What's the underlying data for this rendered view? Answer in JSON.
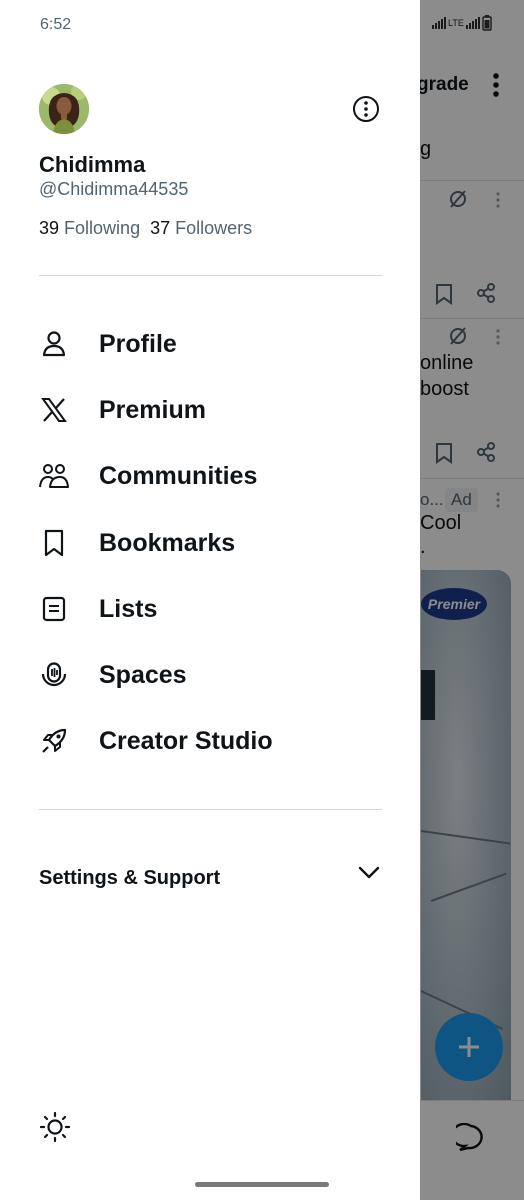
{
  "status_bar": {
    "time": "6:52",
    "signal_icon": "signal-bars-icon",
    "network": "LTE",
    "battery_icon": "battery-icon"
  },
  "profile": {
    "display_name": "Chidimma",
    "handle": "@Chidimma44535",
    "following_count": "39",
    "following_label": "Following",
    "followers_count": "37",
    "followers_label": "Followers",
    "avatar_icon": "avatar",
    "more_icon": "more-options-circle-icon"
  },
  "menu": {
    "items": [
      {
        "label": "Profile",
        "icon": "person-icon"
      },
      {
        "label": "Premium",
        "icon": "x-logo-icon"
      },
      {
        "label": "Communities",
        "icon": "communities-icon"
      },
      {
        "label": "Bookmarks",
        "icon": "bookmark-icon"
      },
      {
        "label": "Lists",
        "icon": "list-icon"
      },
      {
        "label": "Spaces",
        "icon": "spaces-mic-icon"
      },
      {
        "label": "Creator Studio",
        "icon": "rocket-icon"
      }
    ]
  },
  "settings": {
    "label": "Settings & Support",
    "chevron_icon": "chevron-down-icon"
  },
  "footer": {
    "theme_icon": "sun-icon"
  },
  "background_feed": {
    "upgrade_fragment": "grade",
    "tab_fragment": "g",
    "post_text_line1": "online",
    "post_text_line2": "boost",
    "ad_author_fragment": "o...",
    "ad_badge": "Ad",
    "ad_text_fragment": "Cool",
    "ad_dot": ".",
    "media_logo": "Premier",
    "fab_icon": "compose-plus-icon",
    "bottom_icon": "message-icon"
  },
  "colors": {
    "text_primary": "#0f1419",
    "text_secondary": "#536471",
    "divider": "#cfd9de",
    "accent": "#1d9bf0",
    "overlay": "rgba(0,0,0,0.45)"
  }
}
